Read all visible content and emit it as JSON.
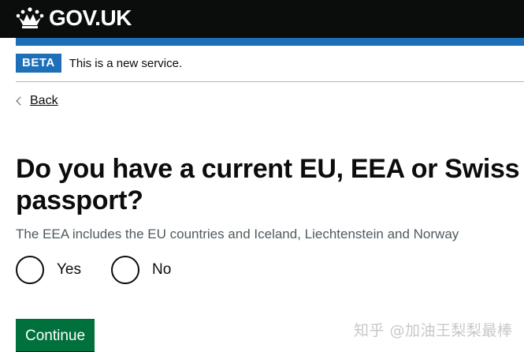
{
  "header": {
    "logo_text": "GOV.UK",
    "background": "#0b0c0c"
  },
  "phase_banner": {
    "tag": "BETA",
    "text": "This is a new service.",
    "accent": "#1d70b8"
  },
  "back_link": {
    "label": "Back"
  },
  "question": {
    "title": "Do you have a current EU, EEA or Swiss passport?",
    "hint": "The EEA includes the EU countries and Iceland, Liechtenstein and Norway",
    "options": [
      {
        "label": "Yes",
        "selected": false
      },
      {
        "label": "No",
        "selected": false
      }
    ]
  },
  "actions": {
    "continue_label": "Continue",
    "continue_color": "#00703c"
  },
  "watermark": {
    "text": "知乎 @加油王梨梨最棒"
  },
  "icons": {
    "logo": "crown-icon",
    "back": "chevron-left-icon"
  }
}
